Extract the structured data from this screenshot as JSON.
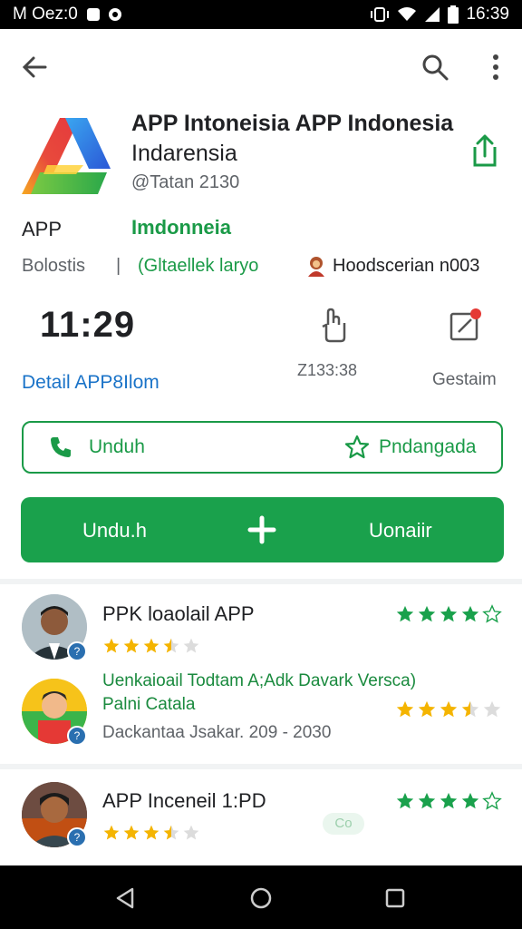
{
  "status_bar": {
    "left_text": "M Oez:0",
    "time": "16:39"
  },
  "app": {
    "title": "APP Intoneisia APP Indonesia",
    "subtitle": "Indarensia",
    "handle": "@Tatan 2130",
    "label_left": "APP",
    "label_right": "Imdonneia"
  },
  "meta": {
    "item1": "Bolostis",
    "separator": "|",
    "item2": "(Gltaellek laryo",
    "item3": "Hoodscerian n003"
  },
  "stats": {
    "time_value": "11:29",
    "detail_link": "Detail APP8Ilom",
    "stat1_value": "Z133:38",
    "stat2_label": "Gestaim"
  },
  "buttons": {
    "outline_left": "Unduh",
    "outline_right": "Pndangada",
    "main_left": "Undu.h",
    "main_right": "Uonaiir"
  },
  "reviews": [
    {
      "title": "PPK loaolail  APP",
      "rating": 4,
      "sub_rating": 3.5,
      "badge": "?"
    },
    {
      "desc_line1": "Uenkaioail Todtam A;Adk Davark Versca)",
      "desc_line2": "Palni Catala",
      "date": "Dackantaa Jsakar. 209 - 2030",
      "rating": 3.5,
      "badge": "?"
    },
    {
      "title": "APP Inceneil 1:PD",
      "rating": 4,
      "sub_rating": 3.5,
      "extra": "Co",
      "badge": "?"
    }
  ],
  "colors": {
    "brand_green": "#1aa14c",
    "link_blue": "#1a73c8",
    "star_gold": "#f4b400"
  }
}
